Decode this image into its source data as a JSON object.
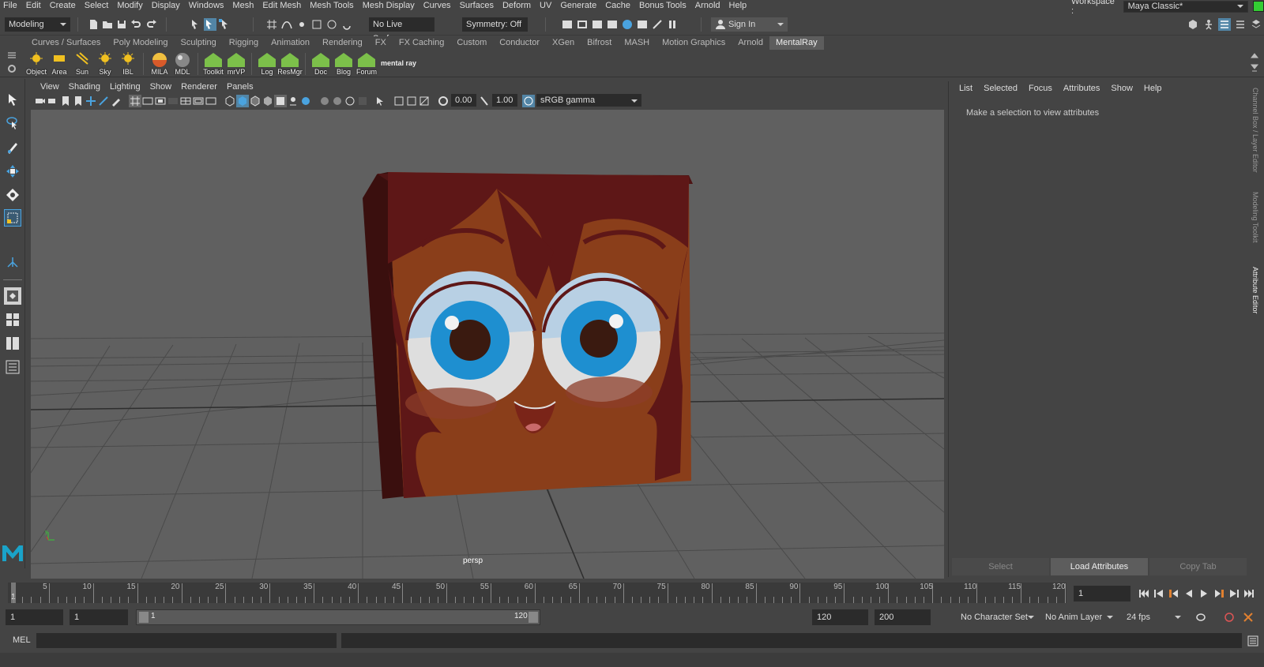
{
  "menu": [
    "File",
    "Edit",
    "Create",
    "Select",
    "Modify",
    "Display",
    "Windows",
    "Mesh",
    "Edit Mesh",
    "Mesh Tools",
    "Mesh Display",
    "Curves",
    "Surfaces",
    "Deform",
    "UV",
    "Generate",
    "Cache",
    "Bonus Tools",
    "Arnold",
    "Help"
  ],
  "workspace": {
    "label": "Workspace :",
    "value": "Maya Classic*"
  },
  "status": {
    "mode": "Modeling",
    "live_surface": "No Live Surface",
    "symmetry": "Symmetry: Off",
    "sign_in": "Sign In"
  },
  "shelf_tabs": [
    {
      "label": "Curves / Surfaces"
    },
    {
      "label": "Poly Modeling"
    },
    {
      "label": "Sculpting"
    },
    {
      "label": "Rigging"
    },
    {
      "label": "Animation"
    },
    {
      "label": "Rendering"
    },
    {
      "label": "FX"
    },
    {
      "label": "FX Caching"
    },
    {
      "label": "Custom"
    },
    {
      "label": "Conductor"
    },
    {
      "label": "XGen"
    },
    {
      "label": "Bifrost"
    },
    {
      "label": "MASH"
    },
    {
      "label": "Motion Graphics"
    },
    {
      "label": "Arnold"
    },
    {
      "label": "MentalRay",
      "active": true
    }
  ],
  "shelf_items": [
    "Object",
    "Area",
    "Sun",
    "Sky",
    "IBL",
    "MILA",
    "MDL",
    "Toolkit",
    "mrVP",
    "Log",
    "ResMgr",
    "Doc",
    "Blog",
    "Forum"
  ],
  "shelf_logo": "mental ray",
  "viewport": {
    "menu": [
      "View",
      "Shading",
      "Lighting",
      "Show",
      "Renderer",
      "Panels"
    ],
    "exposure": "0.00",
    "gamma": "1.00",
    "color_space": "sRGB gamma",
    "camera_label": "persp"
  },
  "channel_box": {
    "menu": [
      "List",
      "Selected",
      "Focus",
      "Attributes",
      "Show",
      "Help"
    ],
    "hint": "Make a selection to view attributes",
    "buttons": [
      "Select",
      "Load Attributes",
      "Copy Tab"
    ]
  },
  "side_tabs": [
    "Channel Box / Layer Editor",
    "Modeling Toolkit",
    "Attribute Editor"
  ],
  "timeline": {
    "ticks": [
      "5",
      "10",
      "15",
      "20",
      "25",
      "30",
      "35",
      "40",
      "45",
      "50",
      "55",
      "60",
      "65",
      "70",
      "75",
      "80",
      "85",
      "90",
      "95",
      "100",
      "105",
      "110",
      "115",
      "120"
    ],
    "start_mark": "1",
    "current_frame": "1"
  },
  "range": {
    "start": "1",
    "playback_start": "1",
    "slider_start": "1",
    "slider_end": "120",
    "playback_end": "120",
    "end": "200",
    "character_set": "No Character Set",
    "anim_layer": "No Anim Layer",
    "fps": "24 fps"
  },
  "command": {
    "lang": "MEL"
  },
  "colors": {
    "accent": "#4aa3df",
    "shelf_green": "#7cc04a",
    "face_skin": "#8a3e1a",
    "hair": "#5e1717",
    "iris": "#1e8fd0"
  }
}
